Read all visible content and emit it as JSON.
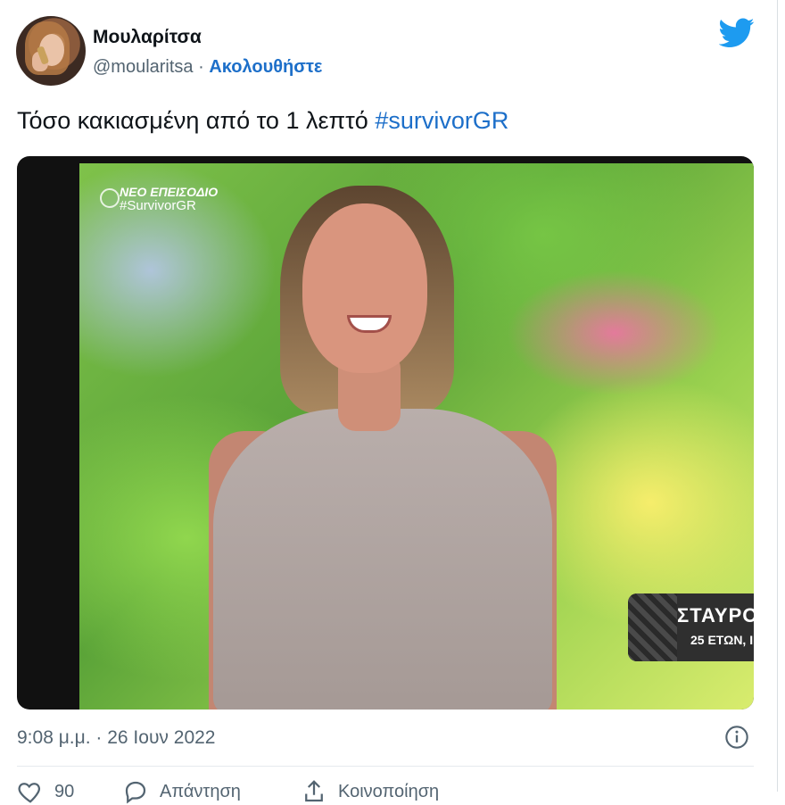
{
  "author": {
    "display_name": "Μουλαρίτσα",
    "handle": "@moularitsa",
    "separator": "·",
    "follow_label": "Ακολουθήστε"
  },
  "tweet": {
    "text": "Τόσο κακιασμένη από το 1 λεπτό",
    "hashtag": "#survivorGR",
    "timestamp": "9:08 μ.μ. · 26 Ιουν 2022"
  },
  "media": {
    "channel_overlay_title": "ΝΕΟ ΕΠΕΙΣΟΔΙΟ",
    "channel_overlay_hashtag": "#SurvivorGR",
    "nameplate_name": "ΣΤΑΥΡΟ",
    "nameplate_age": "25 ΕΤΩΝ, Ι"
  },
  "actions": {
    "likes_count": "90",
    "reply_label": "Απάντηση",
    "share_label": "Κοινοποίηση"
  },
  "colors": {
    "brand": "#1d9bf0",
    "link": "#1d6fc9",
    "muted": "#536471"
  },
  "icons": [
    "twitter-bird-icon",
    "info-icon",
    "heart-icon",
    "reply-icon",
    "share-icon"
  ]
}
